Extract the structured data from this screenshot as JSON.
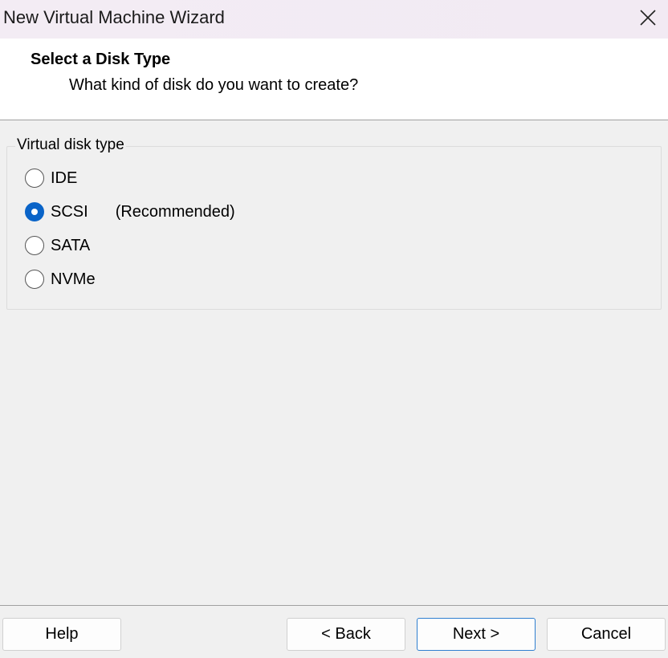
{
  "window": {
    "title": "New Virtual Machine Wizard",
    "close_icon": "close-icon"
  },
  "header": {
    "title": "Select a Disk Type",
    "subtitle": "What kind of disk do you want to create?"
  },
  "disk_type": {
    "legend": "Virtual disk type",
    "selected": "SCSI",
    "options": [
      {
        "label": "IDE",
        "note": "",
        "checked": false
      },
      {
        "label": "SCSI",
        "note": "(Recommended)",
        "checked": true
      },
      {
        "label": "SATA",
        "note": "",
        "checked": false
      },
      {
        "label": "NVMe",
        "note": "",
        "checked": false
      }
    ]
  },
  "footer": {
    "help_label": "Help",
    "back_label": "< Back",
    "next_label": "Next >",
    "cancel_label": "Cancel"
  },
  "colors": {
    "accent": "#0a64c8",
    "default_button_border": "#2f7fd0"
  }
}
